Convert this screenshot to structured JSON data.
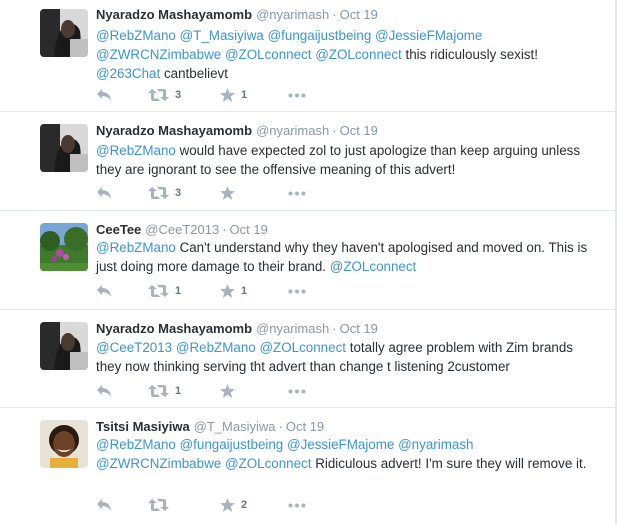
{
  "tweets": [
    {
      "name": "Nyaradzo Mashayamomb",
      "handle": "@nyarimash",
      "date": "Oct 19",
      "text_parts": [
        {
          "t": "@RebZMano",
          "m": true
        },
        {
          "t": " ",
          "m": false
        },
        {
          "t": "@T_Masiyiwa",
          "m": true
        },
        {
          "t": " ",
          "m": false
        },
        {
          "t": "@fungaijustbeing",
          "m": true
        },
        {
          "t": " ",
          "m": false
        },
        {
          "t": "@JessieFMajome",
          "m": true
        },
        {
          "t": " ",
          "m": false
        },
        {
          "t": "@ZWRCNZimbabwe",
          "m": true
        },
        {
          "t": " ",
          "m": false
        },
        {
          "t": "@ZOLconnect",
          "m": true
        },
        {
          "t": " ",
          "m": false
        },
        {
          "t": "@ZOLconnect",
          "m": true
        },
        {
          "t": "  this ridiculously sexist! ",
          "m": false
        },
        {
          "t": "@263Chat",
          "m": true
        },
        {
          "t": " cantbelievt",
          "m": false
        }
      ],
      "retweets": "3",
      "favorites": "1",
      "avatar": "photo-woman-dark"
    },
    {
      "name": "Nyaradzo Mashayamomb",
      "handle": "@nyarimash",
      "date": "Oct 19",
      "text_parts": [
        {
          "t": "@RebZMano",
          "m": true
        },
        {
          "t": "  would have expected zol to just apologize than keep arguing unless they are ignorant to see the offensive meaning of this advert!",
          "m": false
        }
      ],
      "retweets": "3",
      "favorites": "",
      "avatar": "photo-woman-dark"
    },
    {
      "name": "CeeTee",
      "handle": "@CeeT2013",
      "date": "Oct 19",
      "text_parts": [
        {
          "t": "@RebZMano",
          "m": true
        },
        {
          "t": " Can't understand why they haven't apologised and moved on. This is just doing more damage to their brand.  ",
          "m": false
        },
        {
          "t": "@ZOLconnect",
          "m": true
        }
      ],
      "retweets": "1",
      "favorites": "1",
      "avatar": "photo-garden"
    },
    {
      "name": "Nyaradzo Mashayamomb",
      "handle": "@nyarimash",
      "date": "Oct 19",
      "text_parts": [
        {
          "t": "@CeeT2013",
          "m": true
        },
        {
          "t": " ",
          "m": false
        },
        {
          "t": "@RebZMano",
          "m": true
        },
        {
          "t": " ",
          "m": false
        },
        {
          "t": "@ZOLconnect",
          "m": true
        },
        {
          "t": " totally agree problem with Zim brands they now thinking serving tht advert than change t listening 2customer",
          "m": false
        }
      ],
      "retweets": "1",
      "favorites": "",
      "avatar": "photo-woman-dark"
    },
    {
      "name": "Tsitsi Masiyiwa",
      "handle": "@T_Masiyiwa",
      "date": "Oct 19",
      "text_parts": [
        {
          "t": "@RebZMano",
          "m": true
        },
        {
          "t": " ",
          "m": false
        },
        {
          "t": "@fungaijustbeing",
          "m": true
        },
        {
          "t": " ",
          "m": false
        },
        {
          "t": "@JessieFMajome",
          "m": true
        },
        {
          "t": " ",
          "m": false
        },
        {
          "t": "@nyarimash",
          "m": true
        },
        {
          "t": " ",
          "m": false
        },
        {
          "t": "@ZWRCNZimbabwe",
          "m": true
        },
        {
          "t": " ",
          "m": false
        },
        {
          "t": "@ZOLconnect",
          "m": true
        },
        {
          "t": " Ridiculous advert! I'm sure they will remove it.",
          "m": false
        }
      ],
      "retweets": "",
      "favorites": "2",
      "avatar": "photo-smiling-woman"
    }
  ],
  "colors": {
    "mention": "#3b94d9",
    "icon": "#a6b4bf",
    "meta": "#8899a6",
    "divider": "#e1e8ed"
  },
  "icons": {
    "reply": "reply-icon",
    "retweet": "retweet-icon",
    "favorite": "star-icon",
    "more": "more-icon"
  }
}
